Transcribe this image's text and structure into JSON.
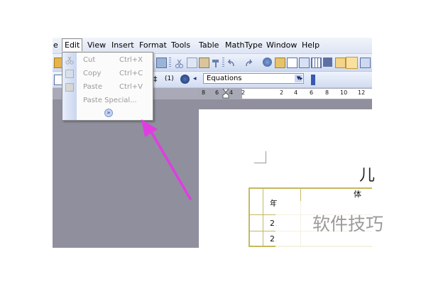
{
  "menubar": {
    "partial": "e",
    "items": [
      "Edit",
      "View",
      "Insert",
      "Format",
      "Tools",
      "Table",
      "MathType",
      "Window",
      "Help"
    ],
    "active": "Edit"
  },
  "toolbar": {
    "equations_dropdown": "Equations"
  },
  "edit_menu": {
    "items": [
      {
        "label": "Cut",
        "shortcut": "Ctrl+X"
      },
      {
        "label": "Copy",
        "shortcut": "Ctrl+C"
      },
      {
        "label": "Paste",
        "shortcut": "Ctrl+V"
      },
      {
        "label": "Paste Special...",
        "shortcut": ""
      }
    ],
    "expand_icon": "chevron-double-down-icon"
  },
  "ruler": {
    "numbers": [
      "8",
      "6",
      "4",
      "2",
      "2",
      "4",
      "6",
      "8",
      "10",
      "12"
    ]
  },
  "document": {
    "title_fragment": "儿",
    "table": {
      "header": [
        "年",
        "体"
      ],
      "rows": [
        "2.",
        "2."
      ]
    }
  },
  "watermark": "软件技巧",
  "annotation": {
    "arrow_color": "#e03de0"
  },
  "colors": {
    "menubar": "#e7ecf7",
    "app_background": "#8f8f9e",
    "table_border": "#c7b860"
  }
}
